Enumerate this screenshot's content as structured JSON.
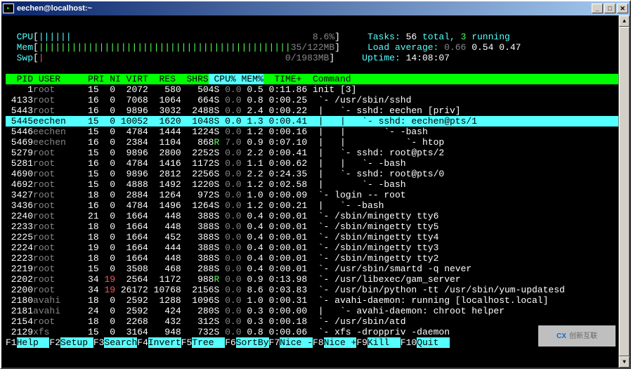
{
  "title": "eechen@localhost:~",
  "meters": {
    "cpu": {
      "label": "CPU",
      "bar": "||||||",
      "val": "8.6%"
    },
    "mem": {
      "label": "Mem",
      "bar": "||||||||||||||||||||||||||||||||||||||||||||||",
      "val": "35/122MB"
    },
    "swp": {
      "label": "Swp",
      "bar": "|",
      "val": "0/1983MB"
    }
  },
  "summary": {
    "tasks_label": "Tasks: ",
    "tasks": "56",
    "tasks_sfx": " total, ",
    "running": "3",
    "running_sfx": " running",
    "la_label": "Load average: ",
    "la1": "0.66",
    "la2": "0.54",
    "la3": "0.47",
    "up_label": "Uptime: ",
    "uptime": "14:08:07"
  },
  "hdr": [
    "  PID",
    " USER     ",
    "PRI",
    " NI",
    " VIRT",
    "  RES",
    "  SHR",
    "S",
    " CPU%",
    " MEM%",
    "  TIME+ ",
    " Command"
  ],
  "rows": [
    {
      "pid": "    1",
      "user": "root     ",
      "pri": " 15",
      "ni": "  0",
      "virt": "  2072",
      "res": "   580",
      "shr": "   504",
      "s": "S",
      "cpu": " 0.0",
      "mem": " 0.5",
      "time": " 0:11.86",
      "cmd": " init [3]"
    },
    {
      "pid": " 4133",
      "user": "root     ",
      "pri": " 16",
      "ni": "  0",
      "virt": "  7068",
      "res": "  1064",
      "shr": "   664",
      "s": "S",
      "cpu": " 0.0",
      "mem": " 0.8",
      "time": " 0:00.25",
      "cmd": "  `- /usr/sbin/sshd"
    },
    {
      "pid": " 5443",
      "user": "root     ",
      "pri": " 16",
      "ni": "  0",
      "virt": "  9896",
      "res": "  3032",
      "shr": "  2488",
      "s": "S",
      "cpu": " 0.0",
      "mem": " 2.4",
      "time": " 0:00.22",
      "cmd": "  |   `- sshd: eechen [priv]"
    },
    {
      "pid": " 5445",
      "user": "eechen   ",
      "pri": " 15",
      "ni": "  0",
      "virt": " 10052",
      "res": "  1620",
      "shr": "  1048",
      "s": "S",
      "cpu": " 0.0",
      "mem": " 1.3",
      "time": " 0:00.41",
      "cmd": "  |   |   `- sshd: eechen@pts/1",
      "sel": true
    },
    {
      "pid": " 5446",
      "user": "eechen   ",
      "pri": " 15",
      "ni": "  0",
      "virt": "  4784",
      "res": "  1444",
      "shr": "  1224",
      "s": "S",
      "cpu": " 0.0",
      "mem": " 1.2",
      "time": " 0:00.16",
      "cmd": "  |   |       `- -bash"
    },
    {
      "pid": " 5469",
      "user": "eechen   ",
      "pri": " 16",
      "ni": "  0",
      "virt": "  2384",
      "res": "  1104",
      "shr": "   868",
      "s": "R",
      "cpu": " 7.0",
      "mem": " 0.9",
      "time": " 0:07.10",
      "cmd": "  |   |           `- htop"
    },
    {
      "pid": " 5279",
      "user": "root     ",
      "pri": " 15",
      "ni": "  0",
      "virt": "  9896",
      "res": "  2800",
      "shr": "  2252",
      "s": "S",
      "cpu": " 0.0",
      "mem": " 2.2",
      "time": " 0:00.41",
      "cmd": "  |   `- sshd: root@pts/2"
    },
    {
      "pid": " 5281",
      "user": "root     ",
      "pri": " 16",
      "ni": "  0",
      "virt": "  4784",
      "res": "  1416",
      "shr": "  1172",
      "s": "S",
      "cpu": " 0.0",
      "mem": " 1.1",
      "time": " 0:00.62",
      "cmd": "  |   |   `- -bash"
    },
    {
      "pid": " 4690",
      "user": "root     ",
      "pri": " 15",
      "ni": "  0",
      "virt": "  9896",
      "res": "  2812",
      "shr": "  2256",
      "s": "S",
      "cpu": " 0.0",
      "mem": " 2.2",
      "time": " 0:24.35",
      "cmd": "  |   `- sshd: root@pts/0"
    },
    {
      "pid": " 4692",
      "user": "root     ",
      "pri": " 15",
      "ni": "  0",
      "virt": "  4888",
      "res": "  1492",
      "shr": "  1220",
      "s": "S",
      "cpu": " 0.0",
      "mem": " 1.2",
      "time": " 0:02.58",
      "cmd": "  |       `- -bash"
    },
    {
      "pid": " 3427",
      "user": "root     ",
      "pri": " 18",
      "ni": "  0",
      "virt": "  2884",
      "res": "  1264",
      "shr": "   972",
      "s": "S",
      "cpu": " 0.0",
      "mem": " 1.0",
      "time": " 0:00.09",
      "cmd": "  `- login -- root"
    },
    {
      "pid": " 3436",
      "user": "root     ",
      "pri": " 16",
      "ni": "  0",
      "virt": "  4784",
      "res": "  1496",
      "shr": "  1264",
      "s": "S",
      "cpu": " 0.0",
      "mem": " 1.2",
      "time": " 0:00.21",
      "cmd": "  |   `- -bash"
    },
    {
      "pid": " 2240",
      "user": "root     ",
      "pri": " 21",
      "ni": "  0",
      "virt": "  1664",
      "res": "   448",
      "shr": "   388",
      "s": "S",
      "cpu": " 0.0",
      "mem": " 0.4",
      "time": " 0:00.01",
      "cmd": "  `- /sbin/mingetty tty6"
    },
    {
      "pid": " 2233",
      "user": "root     ",
      "pri": " 18",
      "ni": "  0",
      "virt": "  1664",
      "res": "   448",
      "shr": "   388",
      "s": "S",
      "cpu": " 0.0",
      "mem": " 0.4",
      "time": " 0:00.01",
      "cmd": "  `- /sbin/mingetty tty5"
    },
    {
      "pid": " 2225",
      "user": "root     ",
      "pri": " 18",
      "ni": "  0",
      "virt": "  1664",
      "res": "   452",
      "shr": "   388",
      "s": "S",
      "cpu": " 0.0",
      "mem": " 0.4",
      "time": " 0:00.01",
      "cmd": "  `- /sbin/mingetty tty4"
    },
    {
      "pid": " 2224",
      "user": "root     ",
      "pri": " 19",
      "ni": "  0",
      "virt": "  1664",
      "res": "   444",
      "shr": "   388",
      "s": "S",
      "cpu": " 0.0",
      "mem": " 0.4",
      "time": " 0:00.01",
      "cmd": "  `- /sbin/mingetty tty3"
    },
    {
      "pid": " 2223",
      "user": "root     ",
      "pri": " 18",
      "ni": "  0",
      "virt": "  1664",
      "res": "   448",
      "shr": "   388",
      "s": "S",
      "cpu": " 0.0",
      "mem": " 0.4",
      "time": " 0:00.01",
      "cmd": "  `- /sbin/mingetty tty2"
    },
    {
      "pid": " 2219",
      "user": "root     ",
      "pri": " 15",
      "ni": "  0",
      "virt": "  3508",
      "res": "   468",
      "shr": "   288",
      "s": "S",
      "cpu": " 0.0",
      "mem": " 0.4",
      "time": " 0:00.01",
      "cmd": "  `- /usr/sbin/smartd -q never"
    },
    {
      "pid": " 2202",
      "user": "root     ",
      "pri": " 34",
      "ni": " 19",
      "virt": "  2564",
      "res": "  1172",
      "shr": "   988",
      "s": "R",
      "cpu": " 0.0",
      "mem": " 0.9",
      "time": " 0:13.98",
      "cmd": "  `- /usr/libexec/gam_server",
      "nired": true
    },
    {
      "pid": " 2200",
      "user": "root     ",
      "pri": " 34",
      "ni": " 19",
      "virt": " 26172",
      "res": " 10768",
      "shr": "  2156",
      "s": "S",
      "cpu": " 0.0",
      "mem": " 8.6",
      "time": " 0:03.83",
      "cmd": "  `- /usr/bin/python -tt /usr/sbin/yum-updatesd",
      "nired": true
    },
    {
      "pid": " 2180",
      "user": "avahi    ",
      "pri": " 18",
      "ni": "  0",
      "virt": "  2592",
      "res": "  1288",
      "shr": "  1096",
      "s": "S",
      "cpu": " 0.0",
      "mem": " 1.0",
      "time": " 0:00.31",
      "cmd": "  `- avahi-daemon: running [localhost.local]"
    },
    {
      "pid": " 2181",
      "user": "avahi    ",
      "pri": " 24",
      "ni": "  0",
      "virt": "  2592",
      "res": "   424",
      "shr": "   280",
      "s": "S",
      "cpu": " 0.0",
      "mem": " 0.3",
      "time": " 0:00.00",
      "cmd": "  |   `- avahi-daemon: chroot helper"
    },
    {
      "pid": " 2154",
      "user": "root     ",
      "pri": " 18",
      "ni": "  0",
      "virt": "  2268",
      "res": "   432",
      "shr": "   312",
      "s": "S",
      "cpu": " 0.0",
      "mem": " 0.3",
      "time": " 0:00.18",
      "cmd": "  `- /usr/sbin/atd"
    },
    {
      "pid": " 2129",
      "user": "xfs      ",
      "pri": " 15",
      "ni": "  0",
      "virt": "  3164",
      "res": "   948",
      "shr": "   732",
      "s": "S",
      "cpu": " 0.0",
      "mem": " 0.8",
      "time": " 0:00.06",
      "cmd": "  `- xfs -droppriv -daemon"
    }
  ],
  "fkeys": [
    {
      "k": "F1",
      "l": "Help  "
    },
    {
      "k": "F2",
      "l": "Setup "
    },
    {
      "k": "F3",
      "l": "Search"
    },
    {
      "k": "F4",
      "l": "Invert"
    },
    {
      "k": "F5",
      "l": "Tree  "
    },
    {
      "k": "F6",
      "l": "SortBy"
    },
    {
      "k": "F7",
      "l": "Nice -"
    },
    {
      "k": "F8",
      "l": "Nice +"
    },
    {
      "k": "F9",
      "l": "Kill  "
    },
    {
      "k": "F10",
      "l": "Quit  "
    }
  ],
  "watermark": "创新互联"
}
